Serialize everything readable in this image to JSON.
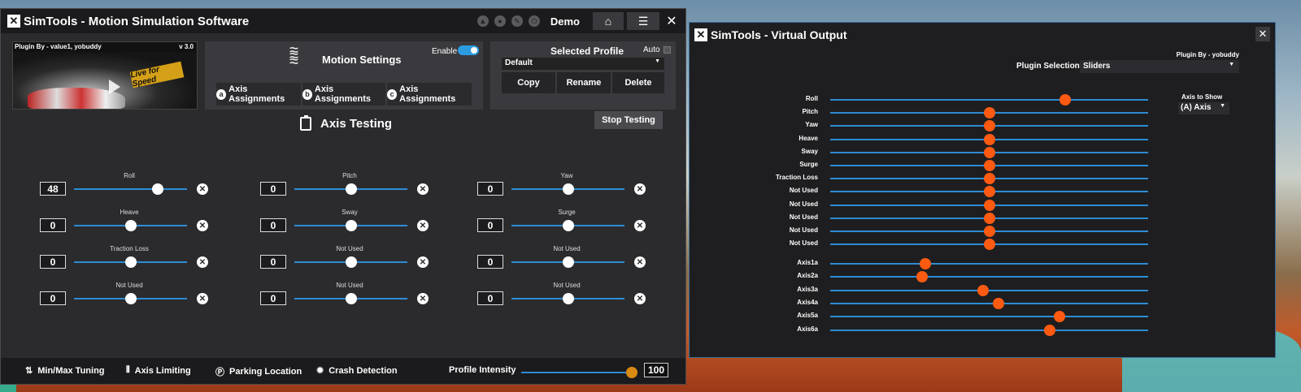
{
  "main_window": {
    "title": "SimTools - Motion Simulation Software",
    "demo_label": "Demo",
    "plugin": {
      "by": "Plugin By - value1, yobuddy",
      "version": "v 3.0",
      "logo_text": "Live for Speed"
    },
    "motion_settings": {
      "title": "Motion Settings",
      "enable_label": "Enable",
      "enabled": true,
      "axis_buttons": [
        {
          "icon": "a",
          "label": "Axis Assignments"
        },
        {
          "icon": "b",
          "label": "Axis Assignments"
        },
        {
          "icon": "c",
          "label": "Axis Assignments"
        }
      ]
    },
    "profile": {
      "title": "Selected Profile",
      "auto_label": "Auto",
      "selected": "Default",
      "buttons": [
        "Copy",
        "Rename",
        "Delete"
      ]
    },
    "axis_testing": {
      "title": "Axis Testing",
      "stop_button": "Stop Testing",
      "axes": [
        {
          "label": "Roll",
          "value": "48",
          "level": 0.74
        },
        {
          "label": "Pitch",
          "value": "0",
          "level": 0.5
        },
        {
          "label": "Yaw",
          "value": "0",
          "level": 0.5
        },
        {
          "label": "Heave",
          "value": "0",
          "level": 0.5
        },
        {
          "label": "Sway",
          "value": "0",
          "level": 0.5
        },
        {
          "label": "Surge",
          "value": "0",
          "level": 0.5
        },
        {
          "label": "Traction Loss",
          "value": "0",
          "level": 0.5
        },
        {
          "label": "Not Used",
          "value": "0",
          "level": 0.5
        },
        {
          "label": "Not Used",
          "value": "0",
          "level": 0.5
        },
        {
          "label": "Not Used",
          "value": "0",
          "level": 0.5
        },
        {
          "label": "Not Used",
          "value": "0",
          "level": 0.5
        },
        {
          "label": "Not Used",
          "value": "0",
          "level": 0.5
        }
      ]
    },
    "bottom_bar": {
      "items": [
        {
          "icon": "min-max-icon",
          "label": "Min/Max Tuning"
        },
        {
          "icon": "axis-limiting-icon",
          "label": "Axis Limiting"
        },
        {
          "icon": "parking-icon",
          "label": "Parking Location"
        },
        {
          "icon": "crash-icon",
          "label": "Crash Detection"
        }
      ],
      "intensity_label": "Profile Intensity",
      "intensity_value": "100",
      "intensity_level": 1.0
    }
  },
  "virtual_output": {
    "title": "SimTools - Virtual Output",
    "plugin_by": "Plugin By - yobuddy",
    "plugin_selection_label": "Plugin Selection",
    "plugin_selection_value": "Sliders",
    "axis_to_show_label": "Axis to Show",
    "axis_to_show_value": "(A) Axis",
    "rows": [
      {
        "label": "Roll",
        "level": 0.74
      },
      {
        "label": "Pitch",
        "level": 0.5
      },
      {
        "label": "Yaw",
        "level": 0.5
      },
      {
        "label": "Heave",
        "level": 0.5
      },
      {
        "label": "Sway",
        "level": 0.5
      },
      {
        "label": "Surge",
        "level": 0.5
      },
      {
        "label": "Traction Loss",
        "level": 0.5
      },
      {
        "label": "Not Used",
        "level": 0.5
      },
      {
        "label": "Not Used",
        "level": 0.5
      },
      {
        "label": "Not Used",
        "level": 0.5
      },
      {
        "label": "Not Used",
        "level": 0.5
      },
      {
        "label": "Not Used",
        "level": 0.5
      }
    ],
    "axis_rows": [
      {
        "label": "Axis1a",
        "level": 0.3
      },
      {
        "label": "Axis2a",
        "level": 0.29
      },
      {
        "label": "Axis3a",
        "level": 0.48
      },
      {
        "label": "Axis4a",
        "level": 0.53
      },
      {
        "label": "Axis5a",
        "level": 0.72
      },
      {
        "label": "Axis6a",
        "level": 0.69
      }
    ]
  }
}
